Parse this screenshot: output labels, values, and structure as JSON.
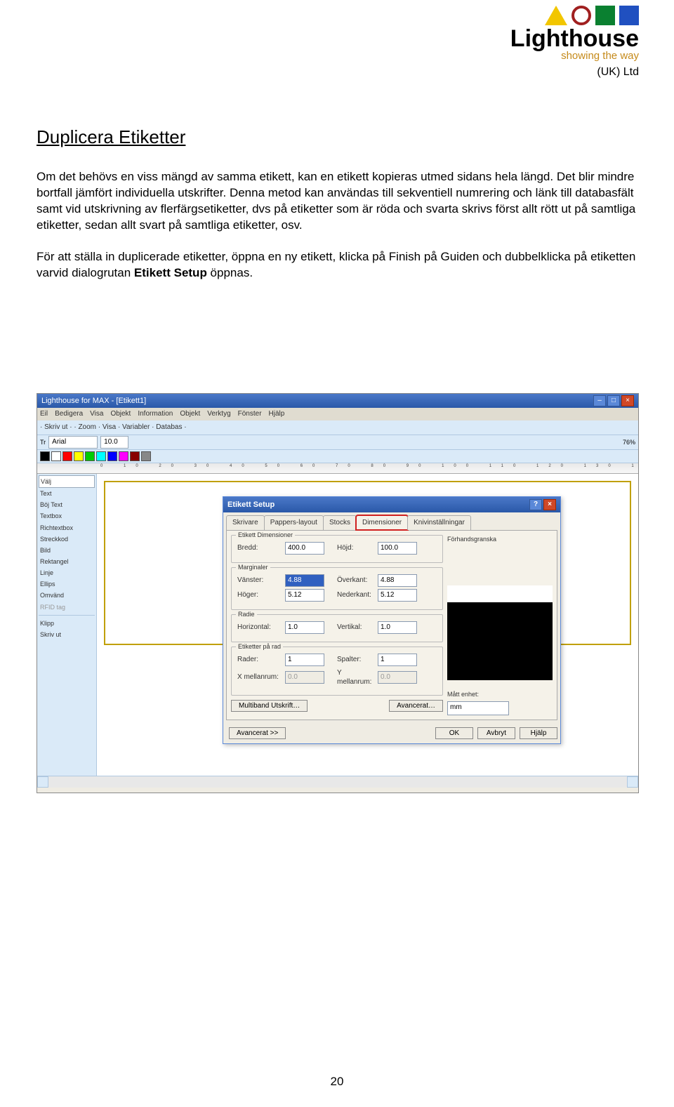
{
  "logo": {
    "main": "Lighthouse",
    "sub": "showing the way",
    "tail": "(UK) Ltd"
  },
  "title": "Duplicera Etiketter",
  "para1": "Om det behövs en viss mängd av samma etikett, kan en etikett kopieras utmed sidans hela längd. Det blir mindre bortfall jämfört individuella utskrifter. Denna metod kan användas till sekventiell numrering och länk till databasfält samt vid utskrivning av flerfärgsetiketter, dvs på etiketter som är röda och svarta skrivs först allt rött ut på samtliga etiketter, sedan allt svart på samtliga etiketter, osv.",
  "para2_a": "För att ställa in duplicerade etiketter, öppna en ny etikett, klicka på Finish på Guiden och dubbelklicka på etiketten varvid dialogrutan ",
  "para2_b": "Etikett Setup",
  "para2_c": " öppnas.",
  "app": {
    "title": "Lighthouse for MAX - [Etikett1]",
    "menus": [
      "Eil",
      "Bedigera",
      "Visa",
      "Objekt",
      "Information",
      "Objekt",
      "Verktyg",
      "Fönster",
      "Hjälp"
    ],
    "toolbar1": "· Skriv ut ·  · Zoom ·  Visa ·   Variabler ·   Databas ·  ",
    "font": "Arial",
    "fontsize": "10.0",
    "zoom": "76%",
    "swatches": [
      "#000",
      "#fff",
      "#f00",
      "#ff0",
      "#0c0",
      "#0ff",
      "#00f",
      "#f0f",
      "#800",
      "#888",
      "#cc8",
      "#088",
      "#48c",
      "#808"
    ],
    "tools": [
      "Välj",
      "Text",
      "Böj Text",
      "Textbox",
      "Richtextbox",
      "Streckkod",
      "Bild",
      "Rektangel",
      "Linje",
      "Ellips",
      "Omvänd",
      "RFID tag"
    ],
    "tools2": [
      "Klipp",
      "Skriv ut"
    ]
  },
  "dialog": {
    "title": "Etikett Setup",
    "tabs": [
      "Skrivare",
      "Pappers-layout",
      "Stocks",
      "Dimensioner",
      "Knivinställningar"
    ],
    "groups": {
      "dim": {
        "legend": "Etikett Dimensioner",
        "bredd_l": "Bredd:",
        "bredd": "400.0",
        "hojd_l": "Höjd:",
        "hojd": "100.0"
      },
      "marg": {
        "legend": "Marginaler",
        "vanster_l": "Vänster:",
        "vanster": "4.88",
        "overkant_l": "Överkant:",
        "overkant": "4.88",
        "hoger_l": "Höger:",
        "hoger": "5.12",
        "nederkant_l": "Nederkant:",
        "nederkant": "5.12"
      },
      "rad": {
        "legend": "Radie",
        "hor_l": "Horizontal:",
        "hor": "1.0",
        "ver_l": "Vertikal:",
        "ver": "1.0"
      },
      "rows": {
        "legend": "Etiketter på rad",
        "rader_l": "Rader:",
        "rader": "1",
        "spalter_l": "Spalter:",
        "spalter": "1",
        "xm_l": "X mellanrum:",
        "xm": "0.0",
        "ym_l": "Y mellanrum:",
        "ym": "0.0"
      }
    },
    "buttons": {
      "multi": "Multiband Utskrift…",
      "avanc": "Avancerat…",
      "adv2": "Avancerat >>",
      "ok": "OK",
      "cancel": "Avbryt",
      "help": "Hjälp"
    },
    "preview": {
      "legend": "Förhandsgranska",
      "unit_l": "Mått enhet:",
      "unit": "mm"
    }
  },
  "page_number": "20"
}
